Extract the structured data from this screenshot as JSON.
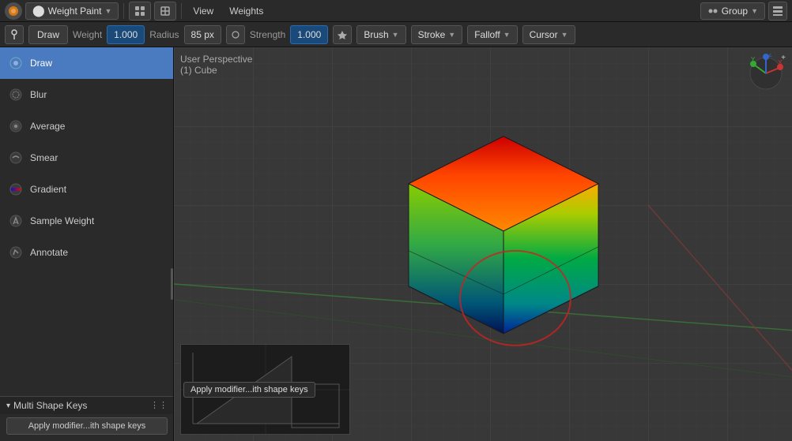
{
  "topbar": {
    "mode_label": "Weight Paint",
    "menu_items": [
      "View",
      "Weights"
    ],
    "group_label": "Group",
    "icons": {
      "mode_icon": "●",
      "grid_icon": "⊞"
    }
  },
  "toolbar": {
    "draw_label": "Draw",
    "weight_label": "Weight",
    "weight_value": "1.000",
    "radius_label": "Radius",
    "radius_value": "85 px",
    "strength_label": "Strength",
    "strength_value": "1.000",
    "brush_label": "Brush",
    "stroke_label": "Stroke",
    "falloff_label": "Falloff",
    "cursor_label": "Cursor"
  },
  "sidebar": {
    "tools": [
      {
        "id": "draw",
        "label": "Draw",
        "active": true
      },
      {
        "id": "blur",
        "label": "Blur",
        "active": false
      },
      {
        "id": "average",
        "label": "Average",
        "active": false
      },
      {
        "id": "smear",
        "label": "Smear",
        "active": false
      },
      {
        "id": "gradient",
        "label": "Gradient",
        "active": false
      },
      {
        "id": "sample-weight",
        "label": "Sample Weight",
        "active": false
      },
      {
        "id": "annotate",
        "label": "Annotate",
        "active": false
      }
    ]
  },
  "bottom_panel": {
    "header": "Multi Shape Keys",
    "apply_btn_label": "Apply modifier...ith shape keys"
  },
  "viewport": {
    "perspective_label": "User Perspective",
    "object_label": "(1) Cube"
  }
}
